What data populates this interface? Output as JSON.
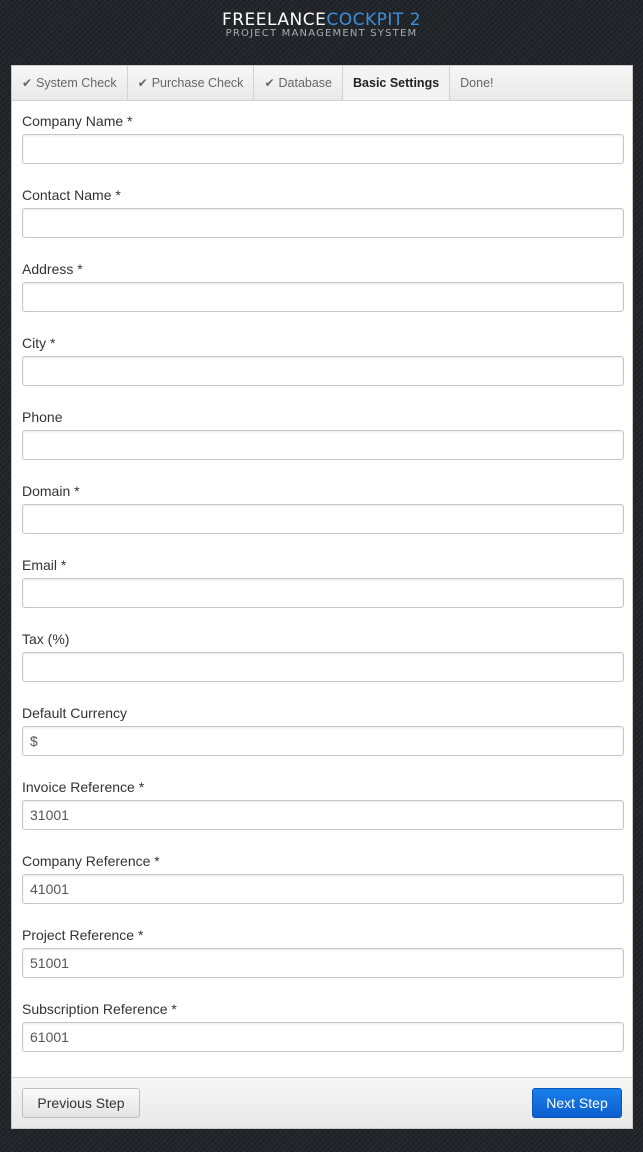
{
  "header": {
    "logo_main": "FREELANCE",
    "logo_accent": "COCKPIT 2",
    "subtitle": "PROJECT MANAGEMENT SYSTEM"
  },
  "tabs": [
    {
      "label": "System Check",
      "done": true
    },
    {
      "label": "Purchase Check",
      "done": true
    },
    {
      "label": "Database",
      "done": true
    },
    {
      "label": "Basic Settings",
      "active": true
    },
    {
      "label": "Done!"
    }
  ],
  "icons": {
    "tab_done": "checkmark-icon"
  },
  "form": {
    "company_name": {
      "label": "Company Name *",
      "value": ""
    },
    "contact_name": {
      "label": "Contact Name *",
      "value": ""
    },
    "address": {
      "label": "Address *",
      "value": ""
    },
    "city": {
      "label": "City *",
      "value": ""
    },
    "phone": {
      "label": "Phone",
      "value": ""
    },
    "domain": {
      "label": "Domain *",
      "value": ""
    },
    "email": {
      "label": "Email *",
      "value": ""
    },
    "tax": {
      "label": "Tax (%)",
      "value": ""
    },
    "default_currency": {
      "label": "Default Currency",
      "value": "$"
    },
    "invoice_reference": {
      "label": "Invoice Reference *",
      "value": "31001"
    },
    "company_reference": {
      "label": "Company Reference *",
      "value": "41001"
    },
    "project_reference": {
      "label": "Project Reference *",
      "value": "51001"
    },
    "subscription_reference": {
      "label": "Subscription Reference *",
      "value": "61001"
    }
  },
  "footer": {
    "previous_label": "Previous Step",
    "next_label": "Next Step"
  },
  "colors": {
    "accent": "#3a8fe0",
    "primary_button": "#0b5fcf",
    "background": "#23272b"
  }
}
